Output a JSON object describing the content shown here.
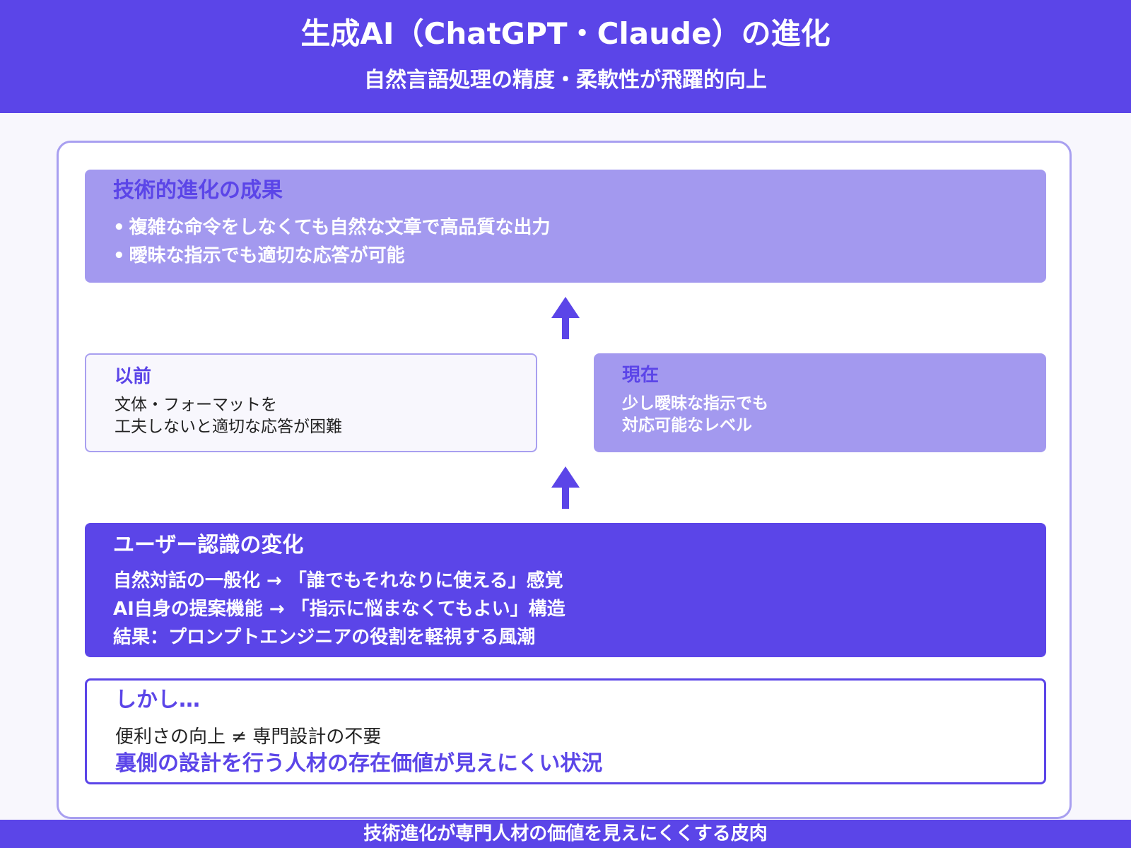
{
  "header": {
    "title": "生成AI（ChatGPT・Claude）の進化",
    "subtitle": "自然言語処理の精度・柔軟性が飛躍的向上"
  },
  "achievements": {
    "title": "技術的進化の成果",
    "bullet": "•",
    "items": [
      "複雑な命令をしなくても自然な文章で高品質な出力",
      "曖昧な指示でも適切な応答が可能"
    ]
  },
  "before": {
    "title": "以前",
    "lines": [
      "文体・フォーマットを",
      "工夫しないと適切な応答が困難"
    ]
  },
  "now": {
    "title": "現在",
    "lines": [
      "少し曖昧な指示でも",
      "対応可能なレベル"
    ]
  },
  "perception": {
    "title": "ユーザー認識の変化",
    "lines": [
      "自然対話の一般化 → 「誰でもそれなりに使える」感覚",
      "AI自身の提案機能 → 「指示に悩まなくてもよい」構造",
      "結果：プロンプトエンジニアの役割を軽視する風潮"
    ]
  },
  "however": {
    "title": "しかし…",
    "line1": "便利さの向上 ≠ 専門設計の不要",
    "line2": "裏側の設計を行う人材の存在価値が見えにくい状況"
  },
  "footer": {
    "text": "技術進化が専門人材の価値を見えにくくする皮肉"
  },
  "colors": {
    "primary": "#5b45e8",
    "light": "#a399ef",
    "border": "#a89ff0",
    "background": "#f8f7fd"
  },
  "icons": {
    "flow_arrow": "arrow-up-icon"
  }
}
